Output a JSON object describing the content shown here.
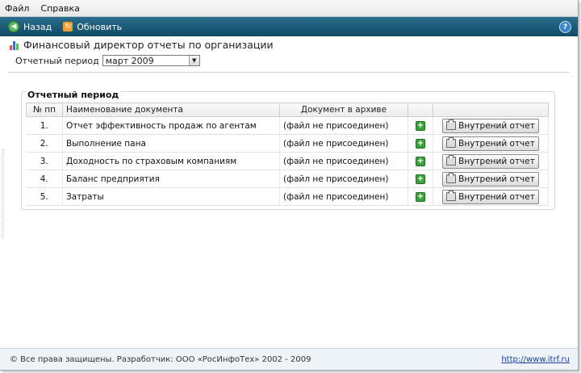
{
  "menu": [
    "Файл",
    "Справка"
  ],
  "toolbar": {
    "back_label": "Назад",
    "refresh_label": "Обновить",
    "help_glyph": "?"
  },
  "page": {
    "title": "Финансовый директор отчеты по организации",
    "period_label": "Отчетный период",
    "period_value": "март 2009",
    "fieldset_legend": "Отчетный период"
  },
  "table": {
    "headers": [
      "№ пп",
      "Наименование документа",
      "Документ в архиве",
      "",
      ""
    ],
    "rows": [
      {
        "num": "1.",
        "name": "Отчет эффективность продаж по агентам",
        "archive": "(файл не присоединен)",
        "button": "Внутрений отчет"
      },
      {
        "num": "2.",
        "name": "Выполнение пана",
        "archive": "(файл не присоединен)",
        "button": "Внутрений отчет"
      },
      {
        "num": "3.",
        "name": "Доходность по страховым компаниям",
        "archive": "(файл не присоединен)",
        "button": "Внутрений отчет"
      },
      {
        "num": "4.",
        "name": "Баланс предприятия",
        "archive": "(файл не присоединен)",
        "button": "Внутрений отчет"
      },
      {
        "num": "5.",
        "name": "Затраты",
        "archive": "(файл не присоединен)",
        "button": "Внутрений отчет"
      }
    ]
  },
  "footer": {
    "copyright": "© Все права защищены. Разработчик: ООО «РосИнфоТех» 2002 - 2009",
    "link": "http://www.itrf.ru"
  },
  "icons": {
    "back": "back-arrow-icon",
    "refresh": "refresh-icon",
    "help": "help-icon",
    "title": "bar-chart-icon",
    "add": "add-file-icon",
    "report": "printer-icon"
  },
  "colors": {
    "toolbar": "#1d5a78",
    "add_icon": "#3aa23a",
    "link": "#1a3fa0"
  }
}
